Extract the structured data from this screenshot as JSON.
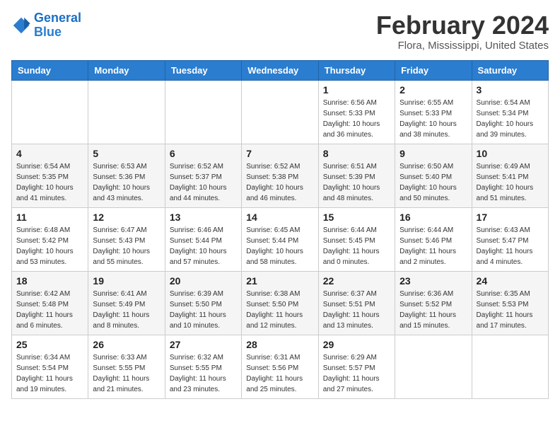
{
  "header": {
    "logo_line1": "General",
    "logo_line2": "Blue",
    "month": "February 2024",
    "location": "Flora, Mississippi, United States"
  },
  "weekdays": [
    "Sunday",
    "Monday",
    "Tuesday",
    "Wednesday",
    "Thursday",
    "Friday",
    "Saturday"
  ],
  "weeks": [
    [
      {
        "day": "",
        "info": ""
      },
      {
        "day": "",
        "info": ""
      },
      {
        "day": "",
        "info": ""
      },
      {
        "day": "",
        "info": ""
      },
      {
        "day": "1",
        "info": "Sunrise: 6:56 AM\nSunset: 5:33 PM\nDaylight: 10 hours\nand 36 minutes."
      },
      {
        "day": "2",
        "info": "Sunrise: 6:55 AM\nSunset: 5:33 PM\nDaylight: 10 hours\nand 38 minutes."
      },
      {
        "day": "3",
        "info": "Sunrise: 6:54 AM\nSunset: 5:34 PM\nDaylight: 10 hours\nand 39 minutes."
      }
    ],
    [
      {
        "day": "4",
        "info": "Sunrise: 6:54 AM\nSunset: 5:35 PM\nDaylight: 10 hours\nand 41 minutes."
      },
      {
        "day": "5",
        "info": "Sunrise: 6:53 AM\nSunset: 5:36 PM\nDaylight: 10 hours\nand 43 minutes."
      },
      {
        "day": "6",
        "info": "Sunrise: 6:52 AM\nSunset: 5:37 PM\nDaylight: 10 hours\nand 44 minutes."
      },
      {
        "day": "7",
        "info": "Sunrise: 6:52 AM\nSunset: 5:38 PM\nDaylight: 10 hours\nand 46 minutes."
      },
      {
        "day": "8",
        "info": "Sunrise: 6:51 AM\nSunset: 5:39 PM\nDaylight: 10 hours\nand 48 minutes."
      },
      {
        "day": "9",
        "info": "Sunrise: 6:50 AM\nSunset: 5:40 PM\nDaylight: 10 hours\nand 50 minutes."
      },
      {
        "day": "10",
        "info": "Sunrise: 6:49 AM\nSunset: 5:41 PM\nDaylight: 10 hours\nand 51 minutes."
      }
    ],
    [
      {
        "day": "11",
        "info": "Sunrise: 6:48 AM\nSunset: 5:42 PM\nDaylight: 10 hours\nand 53 minutes."
      },
      {
        "day": "12",
        "info": "Sunrise: 6:47 AM\nSunset: 5:43 PM\nDaylight: 10 hours\nand 55 minutes."
      },
      {
        "day": "13",
        "info": "Sunrise: 6:46 AM\nSunset: 5:44 PM\nDaylight: 10 hours\nand 57 minutes."
      },
      {
        "day": "14",
        "info": "Sunrise: 6:45 AM\nSunset: 5:44 PM\nDaylight: 10 hours\nand 58 minutes."
      },
      {
        "day": "15",
        "info": "Sunrise: 6:44 AM\nSunset: 5:45 PM\nDaylight: 11 hours\nand 0 minutes."
      },
      {
        "day": "16",
        "info": "Sunrise: 6:44 AM\nSunset: 5:46 PM\nDaylight: 11 hours\nand 2 minutes."
      },
      {
        "day": "17",
        "info": "Sunrise: 6:43 AM\nSunset: 5:47 PM\nDaylight: 11 hours\nand 4 minutes."
      }
    ],
    [
      {
        "day": "18",
        "info": "Sunrise: 6:42 AM\nSunset: 5:48 PM\nDaylight: 11 hours\nand 6 minutes."
      },
      {
        "day": "19",
        "info": "Sunrise: 6:41 AM\nSunset: 5:49 PM\nDaylight: 11 hours\nand 8 minutes."
      },
      {
        "day": "20",
        "info": "Sunrise: 6:39 AM\nSunset: 5:50 PM\nDaylight: 11 hours\nand 10 minutes."
      },
      {
        "day": "21",
        "info": "Sunrise: 6:38 AM\nSunset: 5:50 PM\nDaylight: 11 hours\nand 12 minutes."
      },
      {
        "day": "22",
        "info": "Sunrise: 6:37 AM\nSunset: 5:51 PM\nDaylight: 11 hours\nand 13 minutes."
      },
      {
        "day": "23",
        "info": "Sunrise: 6:36 AM\nSunset: 5:52 PM\nDaylight: 11 hours\nand 15 minutes."
      },
      {
        "day": "24",
        "info": "Sunrise: 6:35 AM\nSunset: 5:53 PM\nDaylight: 11 hours\nand 17 minutes."
      }
    ],
    [
      {
        "day": "25",
        "info": "Sunrise: 6:34 AM\nSunset: 5:54 PM\nDaylight: 11 hours\nand 19 minutes."
      },
      {
        "day": "26",
        "info": "Sunrise: 6:33 AM\nSunset: 5:55 PM\nDaylight: 11 hours\nand 21 minutes."
      },
      {
        "day": "27",
        "info": "Sunrise: 6:32 AM\nSunset: 5:55 PM\nDaylight: 11 hours\nand 23 minutes."
      },
      {
        "day": "28",
        "info": "Sunrise: 6:31 AM\nSunset: 5:56 PM\nDaylight: 11 hours\nand 25 minutes."
      },
      {
        "day": "29",
        "info": "Sunrise: 6:29 AM\nSunset: 5:57 PM\nDaylight: 11 hours\nand 27 minutes."
      },
      {
        "day": "",
        "info": ""
      },
      {
        "day": "",
        "info": ""
      }
    ]
  ]
}
